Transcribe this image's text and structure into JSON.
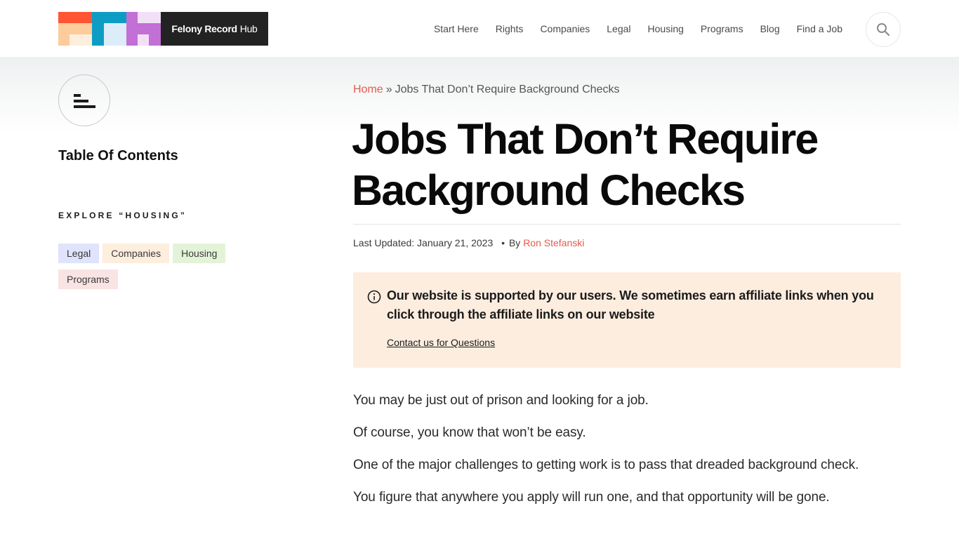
{
  "header": {
    "logo": {
      "brand_bold": "Felony Record",
      "brand_light": "Hub",
      "colors": {
        "red": "#ff5533",
        "peach": "#fccc9c",
        "cream": "#fdeedd",
        "teal": "#0d9dc4",
        "ice": "#dcedf8",
        "purple": "#c26fd6",
        "lavender": "#f3e0f8",
        "dark": "#222222"
      }
    },
    "nav": [
      {
        "label": "Start Here"
      },
      {
        "label": "Rights"
      },
      {
        "label": "Companies"
      },
      {
        "label": "Legal"
      },
      {
        "label": "Housing"
      },
      {
        "label": "Programs"
      },
      {
        "label": "Blog"
      },
      {
        "label": "Find a Job"
      }
    ],
    "search_icon": "search-icon"
  },
  "sidebar": {
    "toc_toggle_icon": "toc-menu-icon",
    "toc_title": "Table Of Contents",
    "explore_title": "Explore “Housing”",
    "tags": [
      {
        "label": "Legal",
        "color": "#dfe3fb"
      },
      {
        "label": "Companies",
        "color": "#fdeedd"
      },
      {
        "label": "Housing",
        "color": "#e3f3d8"
      },
      {
        "label": "Programs",
        "color": "#f9e3e3"
      }
    ]
  },
  "article": {
    "breadcrumb": {
      "home": "Home",
      "separator": "»",
      "current": "Jobs That Don’t Require Background Checks"
    },
    "title": "Jobs That Don’t Require Background Checks",
    "meta": {
      "updated": "Last Updated: January 21, 2023",
      "dot": "•",
      "by": "By",
      "author": "Ron Stefanski"
    },
    "notice": {
      "icon": "info-icon",
      "text": "Our website is supported by our users. We sometimes earn affiliate links when you click through the affiliate links on our website",
      "link": "Contact us for Questions",
      "bg_color": "#fdeddf"
    },
    "paragraphs": [
      "You may be just out of prison and looking for a job.",
      "Of course, you know that won’t be easy.",
      "One of the major challenges to getting work is to pass that dreaded background check.",
      "You figure that anywhere you apply will run one, and that opportunity will be gone."
    ]
  },
  "colors": {
    "accent": "#e35b51",
    "text": "#1b1b1b"
  }
}
